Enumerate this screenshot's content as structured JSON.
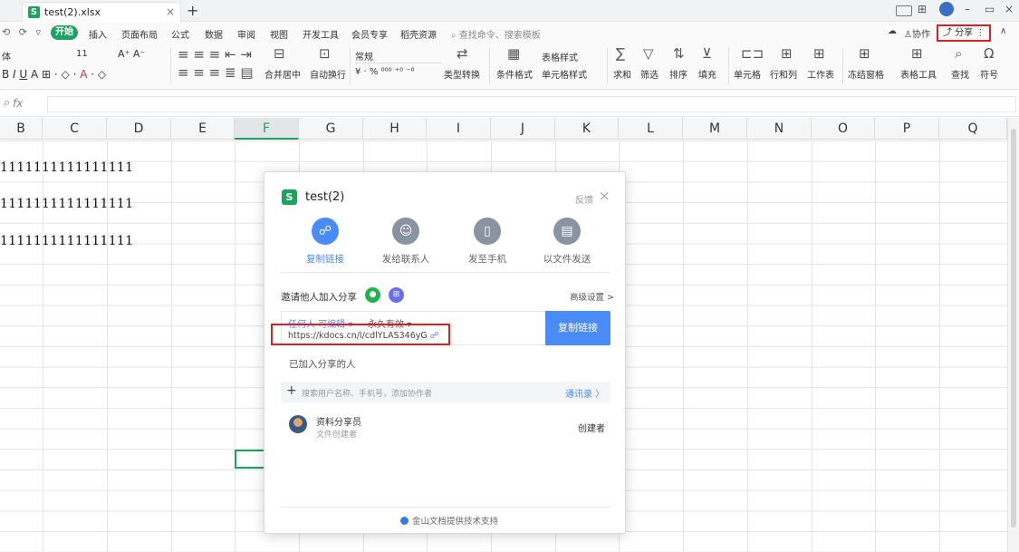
{
  "titlebar": {
    "tab_title": "test(2).xlsx",
    "tab_close": "×",
    "new_tab": "+",
    "logo_letter": "S"
  },
  "menubar": {
    "qat": [
      "⟲",
      "⟳",
      "▿"
    ],
    "start": "开始",
    "items": [
      "插入",
      "页面布局",
      "公式",
      "数据",
      "审阅",
      "视图",
      "开发工具",
      "会员专享",
      "稻壳资源"
    ],
    "search": "查找命令、搜索模板",
    "cloud_icon": "cloud-icon",
    "collab": "协作",
    "share": "分享",
    "collapse": "∧"
  },
  "toolbar": {
    "font_name": "体",
    "font_size": "11",
    "grow": "A⁺ A⁻",
    "merge": "合并居中",
    "wrap": "自动换行",
    "number_format": "常规",
    "convert": "类型转换",
    "cond_format": "条件格式",
    "table_style": "表格样式",
    "cell_style": "单元格样式",
    "sum": "求和",
    "filter": "筛选",
    "sort": "排序",
    "fill": "填充",
    "cell": "单元格",
    "rowcol": "行和列",
    "sheet": "工作表",
    "freeze": "冻结窗格",
    "tools": "表格工具",
    "find": "查找",
    "symbol": "符号",
    "percent": "¥ · % ⁰⁰⁰ ⁺⁰ ⁻⁰"
  },
  "formula": {
    "fx": "fx"
  },
  "columns": [
    "B",
    "C",
    "D",
    "E",
    "F",
    "G",
    "H",
    "I",
    "J",
    "K",
    "L",
    "M",
    "N",
    "O",
    "P",
    "Q"
  ],
  "active_column": "F",
  "cells": [
    "1111111111111111",
    "1111111111111111",
    "1111111111111111"
  ],
  "dialog": {
    "title": "test(2)",
    "feedback": "反馈",
    "close": "×",
    "options": [
      {
        "label": "复制链接",
        "icon": "link-icon",
        "glyph": "🔗"
      },
      {
        "label": "发给联系人",
        "icon": "person-icon",
        "glyph": "👤"
      },
      {
        "label": "发至手机",
        "icon": "phone-icon",
        "glyph": "▯"
      },
      {
        "label": "以文件发送",
        "icon": "file-icon",
        "glyph": "▤"
      }
    ],
    "invite": "邀请他人加入分享",
    "advanced": "高级设置 >",
    "permission": "任何人 可编辑 ▾",
    "validity": "永久有效 ▾",
    "url": "https://kdocs.cn/l/cdlYLAS346yG",
    "copy_button": "复制链接",
    "joined": "已加入分享的人",
    "search_placeholder": "搜索用户名称、手机号，添加协作者",
    "contacts": "通讯录 〉",
    "user": {
      "name": "资料分享员",
      "sub": "文件创建者",
      "role": "创建者"
    },
    "footer": "金山文档提供技术支持"
  }
}
